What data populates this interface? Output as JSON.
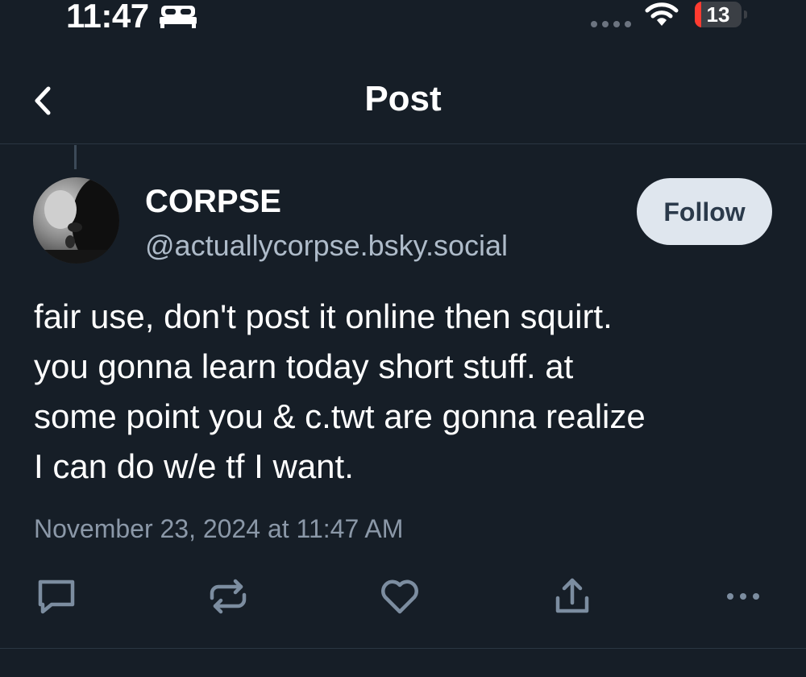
{
  "status_bar": {
    "time": "11:47",
    "battery": "13",
    "battery_level": 0.13,
    "battery_color": "#ff3b30",
    "icons": [
      "sleep-bed-icon",
      "signal-dots-icon",
      "wifi-icon",
      "battery-icon"
    ]
  },
  "header": {
    "title": "Post",
    "back_icon": "chevron-left-icon"
  },
  "post": {
    "author_name": "CORPSE",
    "author_handle": "@actuallycorpse.bsky.social",
    "follow_label": "Follow",
    "text": "fair use, don't post it online then squirt.\nyou gonna learn today short stuff. at\nsome point you & c.twt are gonna realize\nI can do w/e tf I want.",
    "timestamp": "November 23, 2024 at 11:47 AM"
  },
  "actions": [
    {
      "icon": "reply-icon"
    },
    {
      "icon": "repost-icon"
    },
    {
      "icon": "like-heart-icon"
    },
    {
      "icon": "share-icon"
    },
    {
      "icon": "more-options-icon"
    }
  ],
  "colors": {
    "background": "#161e27",
    "text_secondary": "#aebbc9",
    "icon": "#7c8da0",
    "follow_bg": "#dfe6ee"
  }
}
